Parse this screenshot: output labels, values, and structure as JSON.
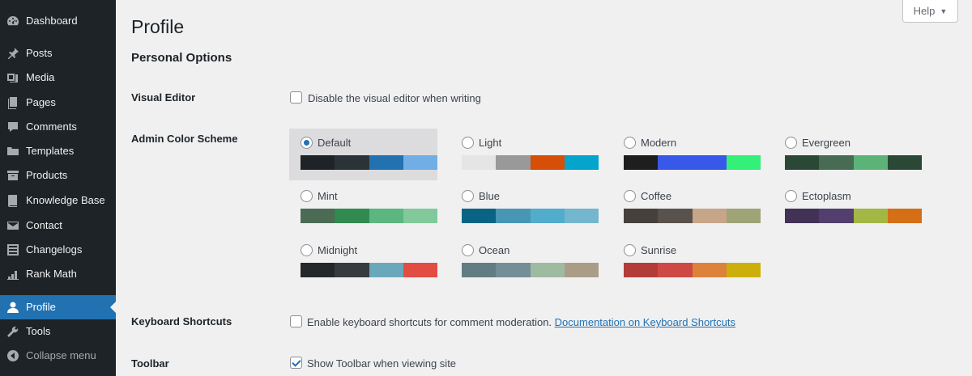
{
  "sidebar": {
    "items": [
      {
        "label": "Dashboard",
        "icon": "dashboard-icon"
      },
      {
        "label": "Posts",
        "icon": "pin-icon"
      },
      {
        "label": "Media",
        "icon": "media-icon"
      },
      {
        "label": "Pages",
        "icon": "pages-icon"
      },
      {
        "label": "Comments",
        "icon": "comments-icon"
      },
      {
        "label": "Templates",
        "icon": "folder-icon"
      },
      {
        "label": "Products",
        "icon": "archive-icon"
      },
      {
        "label": "Knowledge Base",
        "icon": "book-icon"
      },
      {
        "label": "Contact",
        "icon": "mail-icon"
      },
      {
        "label": "Changelogs",
        "icon": "list-icon"
      },
      {
        "label": "Rank Math",
        "icon": "chart-icon"
      },
      {
        "label": "Profile",
        "icon": "user-icon",
        "active": true
      },
      {
        "label": "Tools",
        "icon": "wrench-icon"
      },
      {
        "label": "Collapse menu",
        "icon": "collapse-icon"
      }
    ]
  },
  "help": {
    "label": "Help",
    "caret": "▼"
  },
  "page": {
    "title": "Profile",
    "section": "Personal Options",
    "visual_editor": {
      "label": "Visual Editor",
      "checkbox_text": "Disable the visual editor when writing",
      "checked": false
    },
    "color_scheme": {
      "label": "Admin Color Scheme",
      "selected": "Default",
      "schemes": [
        {
          "name": "Default",
          "colors": [
            "#1d2327",
            "#2c3338",
            "#2271b1",
            "#72aee6"
          ]
        },
        {
          "name": "Light",
          "colors": [
            "#e5e5e5",
            "#999999",
            "#d64e07",
            "#04a4cc"
          ]
        },
        {
          "name": "Modern",
          "colors": [
            "#1e1e1e",
            "#3858e9",
            "#3858e9",
            "#33f078"
          ]
        },
        {
          "name": "Evergreen",
          "colors": [
            "#2b4837",
            "#476b53",
            "#5cb378",
            "#2b4837"
          ]
        },
        {
          "name": "Mint",
          "colors": [
            "#4b6b55",
            "#318a4f",
            "#5cb67f",
            "#81c99b"
          ]
        },
        {
          "name": "Blue",
          "colors": [
            "#096484",
            "#4796b3",
            "#52accc",
            "#74b6ce"
          ]
        },
        {
          "name": "Coffee",
          "colors": [
            "#46403c",
            "#59524c",
            "#c7a589",
            "#9ea476"
          ]
        },
        {
          "name": "Ectoplasm",
          "colors": [
            "#413256",
            "#523f6d",
            "#a3b745",
            "#d46f15"
          ]
        },
        {
          "name": "Midnight",
          "colors": [
            "#25282b",
            "#363b3f",
            "#69a8bb",
            "#e14d43"
          ]
        },
        {
          "name": "Ocean",
          "colors": [
            "#627c83",
            "#738e96",
            "#9ebaa0",
            "#aa9d88"
          ]
        },
        {
          "name": "Sunrise",
          "colors": [
            "#b43c38",
            "#cf4944",
            "#dd823b",
            "#ccaf0b"
          ]
        }
      ]
    },
    "keyboard_shortcuts": {
      "label": "Keyboard Shortcuts",
      "checkbox_text": "Enable keyboard shortcuts for comment moderation.",
      "link_text": "Documentation on Keyboard Shortcuts",
      "checked": false
    },
    "toolbar": {
      "label": "Toolbar",
      "checkbox_text": "Show Toolbar when viewing site",
      "checked": true
    }
  },
  "colors": {
    "sidebar_bg": "#1d2327",
    "accent": "#2271b1",
    "page_bg": "#f0f0f1"
  }
}
